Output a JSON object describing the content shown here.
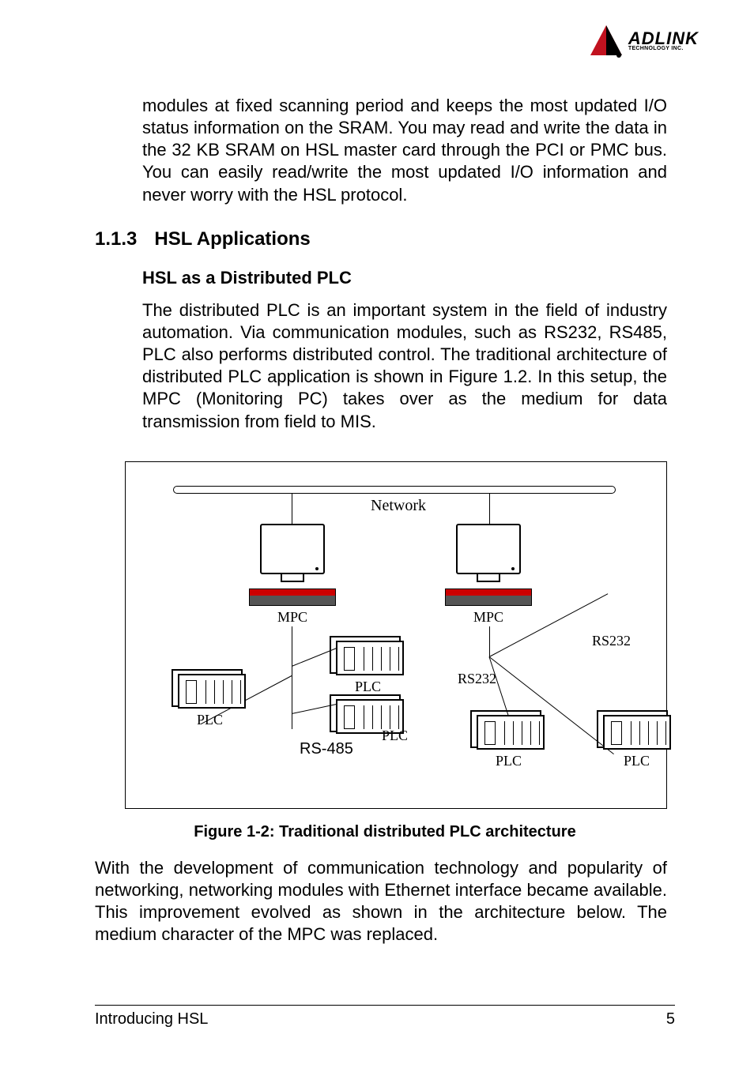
{
  "logo": {
    "main": "ADLINK",
    "sub": "TECHNOLOGY INC.",
    "sub2": ""
  },
  "para1": "modules at fixed scanning period and keeps the most updated I/O status information on the SRAM. You may read and write the data in the 32 KB SRAM on HSL master card through the PCI or PMC bus. You can easily read/write the most updated I/O information and never worry with the HSL protocol.",
  "h3_num": "1.1.3",
  "h3_title": "HSL Applications",
  "h4": "HSL as a Distributed PLC",
  "para2": "The distributed PLC is an important system in the field of industry automation. Via communication modules, such as RS232, RS485, PLC also performs distributed control. The traditional architecture of distributed PLC application is shown in Figure 1.2. In this setup, the MPC (Monitoring PC) takes over as the medium for data transmission from field to MIS.",
  "figure": {
    "network": "Network",
    "mpc": "MPC",
    "plc": "PLC",
    "rs232": "RS232",
    "rs485": "RS-485",
    "caption": "Figure 1-2: Traditional distributed PLC architecture"
  },
  "para3": "With the development of communication technology and popularity of networking, networking modules with Ethernet interface became available. This improvement evolved as shown in the architecture below. The medium character of the MPC was replaced.",
  "footer": {
    "left": "Introducing HSL",
    "right": "5"
  }
}
